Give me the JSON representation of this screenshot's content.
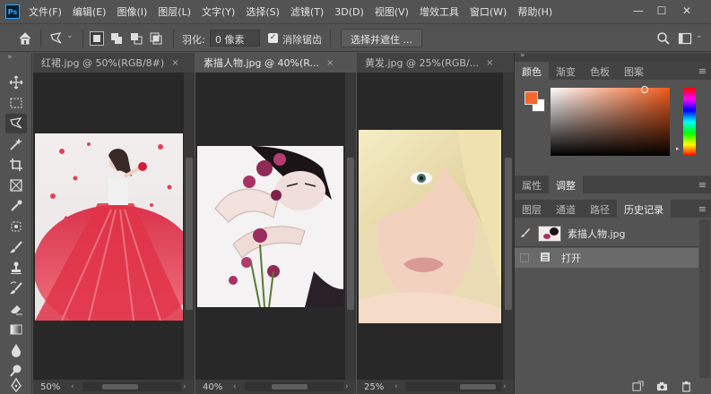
{
  "app": {
    "logo_text": "Ps"
  },
  "menu": [
    "文件(F)",
    "编辑(E)",
    "图像(I)",
    "图层(L)",
    "文字(Y)",
    "选择(S)",
    "滤镜(T)",
    "3D(D)",
    "视图(V)",
    "增效工具",
    "窗口(W)",
    "帮助(H)"
  ],
  "window_controls": {
    "minimize": "—",
    "maximize": "☐",
    "close": "✕"
  },
  "options": {
    "feather_label": "羽化:",
    "feather_value": "0 像素",
    "antialias_label": "消除锯齿",
    "antialias_checked": true,
    "select_mask_label": "选择并遮住 ..."
  },
  "documents": [
    {
      "tab": "红裙.jpg @ 50%(RGB/8#)",
      "close": "×",
      "zoom": "50%",
      "active": false
    },
    {
      "tab": "素描人物.jpg @ 40%(R...",
      "close": "×",
      "zoom": "40%",
      "active": true
    },
    {
      "tab": "黄发.jpg @ 25%(RGB/...",
      "close": "×",
      "zoom": "25%",
      "active": false
    }
  ],
  "color_panel": {
    "tabs": [
      "颜色",
      "渐变",
      "色板",
      "图案"
    ],
    "foreground": "#f0682b",
    "background": "#ffffff",
    "hue_color": "#f05a1a"
  },
  "props_panel": {
    "tabs": [
      "属性",
      "调整"
    ]
  },
  "history_panel": {
    "tabs": [
      "图层",
      "通道",
      "路径",
      "历史记录"
    ],
    "snapshot_name": "素描人物.jpg",
    "states": [
      "打开"
    ]
  },
  "icons": [
    "home-icon",
    "lasso-icon",
    "search-icon",
    "workspace-icon",
    "move-icon",
    "marquee-icon",
    "polygon-lasso-icon",
    "magic-wand-icon",
    "crop-icon",
    "frame-icon",
    "eyedropper-icon",
    "healing-icon",
    "brush-icon",
    "stamp-icon",
    "history-brush-icon",
    "eraser-icon",
    "gradient-icon",
    "blur-icon",
    "dodge-icon",
    "pen-icon"
  ]
}
